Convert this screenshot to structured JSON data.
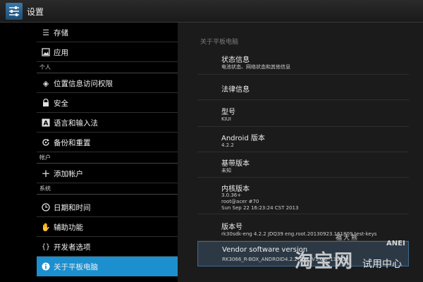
{
  "window": {
    "title": "设置",
    "icon": "settings-sliders-icon"
  },
  "sidebar": {
    "items": [
      {
        "type": "item",
        "label": "存储",
        "icon": "storage-icon"
      },
      {
        "type": "item",
        "label": "应用",
        "icon": "apps-icon"
      },
      {
        "type": "header",
        "label": "个人"
      },
      {
        "type": "item",
        "label": "位置信息访问权限",
        "icon": "location-icon"
      },
      {
        "type": "item",
        "label": "安全",
        "icon": "lock-icon"
      },
      {
        "type": "item",
        "label": "语言和输入法",
        "icon": "keyboard-icon"
      },
      {
        "type": "item",
        "label": "备份和重置",
        "icon": "backup-icon"
      },
      {
        "type": "header",
        "label": "帐户"
      },
      {
        "type": "item",
        "label": "添加帐户",
        "icon": "plus-icon"
      },
      {
        "type": "header",
        "label": "系统"
      },
      {
        "type": "item",
        "label": "日期和时间",
        "icon": "clock-icon"
      },
      {
        "type": "item",
        "label": "辅助功能",
        "icon": "hand-icon"
      },
      {
        "type": "item",
        "label": "开发者选项",
        "icon": "braces-icon"
      },
      {
        "type": "item",
        "label": "关于平板电脑",
        "icon": "info-icon",
        "selected": true
      }
    ]
  },
  "about": {
    "breadcrumb": "关于平板电脑",
    "entries": [
      {
        "title": "状态信息",
        "lines": [
          "电池状态、网络状态和其他信息"
        ]
      },
      {
        "title": "法律信息",
        "lines": []
      },
      {
        "title": "型号",
        "lines": [
          "KIUI"
        ]
      },
      {
        "title": "Android 版本",
        "lines": [
          "4.2.2"
        ]
      },
      {
        "title": "基带版本",
        "lines": [
          "未知"
        ]
      },
      {
        "title": "内核版本",
        "lines": [
          "3.0.36+",
          "root@acer #70",
          "Sun Sep 22 16:23:24 CST 2013"
        ]
      },
      {
        "title": "版本号",
        "lines": [
          "rk30sdk-eng 4.2.2 JDQ39 eng.root.20130923.161809 test-keys"
        ]
      },
      {
        "title": "Vendor software version",
        "lines": [
          "RK3066_R-BOX_ANDROID4.2.2-SDK_V1.0.0_130828"
        ],
        "highlighted": true
      }
    ]
  },
  "watermark": {
    "brand": "ANEI",
    "mascot": "福大熊",
    "main": "淘宝网",
    "sub": "试用中心"
  }
}
